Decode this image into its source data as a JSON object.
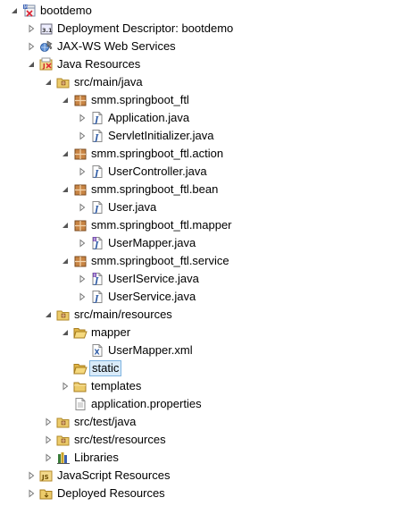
{
  "tree": [
    {
      "id": "bootdemo",
      "label": "bootdemo",
      "depth": 0,
      "arrow": "expanded",
      "icon": "project-icon"
    },
    {
      "id": "deployment-descriptor",
      "label": "Deployment Descriptor: bootdemo",
      "depth": 1,
      "arrow": "collapsed",
      "icon": "deployment-descriptor-icon"
    },
    {
      "id": "jax-ws",
      "label": "JAX-WS Web Services",
      "depth": 1,
      "arrow": "collapsed",
      "icon": "web-services-icon"
    },
    {
      "id": "java-resources",
      "label": "Java Resources",
      "depth": 1,
      "arrow": "expanded",
      "icon": "java-resources-icon"
    },
    {
      "id": "src-main-java",
      "label": "src/main/java",
      "depth": 2,
      "arrow": "expanded",
      "icon": "source-folder-icon"
    },
    {
      "id": "pkg-ftl",
      "label": "smm.springboot_ftl",
      "depth": 3,
      "arrow": "expanded",
      "icon": "package-icon"
    },
    {
      "id": "application-java",
      "label": "Application.java",
      "depth": 4,
      "arrow": "collapsed",
      "icon": "java-file-icon"
    },
    {
      "id": "servletinitializer-java",
      "label": "ServletInitializer.java",
      "depth": 4,
      "arrow": "collapsed",
      "icon": "java-file-icon"
    },
    {
      "id": "pkg-action",
      "label": "smm.springboot_ftl.action",
      "depth": 3,
      "arrow": "expanded",
      "icon": "package-icon"
    },
    {
      "id": "usercontroller-java",
      "label": "UserController.java",
      "depth": 4,
      "arrow": "collapsed",
      "icon": "java-file-icon"
    },
    {
      "id": "pkg-bean",
      "label": "smm.springboot_ftl.bean",
      "depth": 3,
      "arrow": "expanded",
      "icon": "package-icon"
    },
    {
      "id": "user-java",
      "label": "User.java",
      "depth": 4,
      "arrow": "collapsed",
      "icon": "java-file-icon"
    },
    {
      "id": "pkg-mapper",
      "label": "smm.springboot_ftl.mapper",
      "depth": 3,
      "arrow": "expanded",
      "icon": "package-icon"
    },
    {
      "id": "usermapper-java",
      "label": "UserMapper.java",
      "depth": 4,
      "arrow": "collapsed",
      "icon": "java-interface-icon"
    },
    {
      "id": "pkg-service",
      "label": "smm.springboot_ftl.service",
      "depth": 3,
      "arrow": "expanded",
      "icon": "package-icon"
    },
    {
      "id": "useriservice-java",
      "label": "UserIService.java",
      "depth": 4,
      "arrow": "collapsed",
      "icon": "java-interface-icon"
    },
    {
      "id": "userservice-java",
      "label": "UserService.java",
      "depth": 4,
      "arrow": "collapsed",
      "icon": "java-file-icon"
    },
    {
      "id": "src-main-resources",
      "label": "src/main/resources",
      "depth": 2,
      "arrow": "expanded",
      "icon": "source-folder-icon"
    },
    {
      "id": "mapper-folder",
      "label": "mapper",
      "depth": 3,
      "arrow": "expanded",
      "icon": "open-folder-icon"
    },
    {
      "id": "usermapper-xml",
      "label": "UserMapper.xml",
      "depth": 4,
      "arrow": "none",
      "icon": "xml-file-icon"
    },
    {
      "id": "static-folder",
      "label": "static",
      "depth": 3,
      "arrow": "none",
      "icon": "open-folder-icon",
      "selected": true
    },
    {
      "id": "templates-folder",
      "label": "templates",
      "depth": 3,
      "arrow": "collapsed",
      "icon": "folder-icon"
    },
    {
      "id": "application-properties",
      "label": "application.properties",
      "depth": 3,
      "arrow": "none",
      "icon": "properties-file-icon"
    },
    {
      "id": "src-test-java",
      "label": "src/test/java",
      "depth": 2,
      "arrow": "collapsed",
      "icon": "source-folder-icon"
    },
    {
      "id": "src-test-resources",
      "label": "src/test/resources",
      "depth": 2,
      "arrow": "collapsed",
      "icon": "source-folder-icon"
    },
    {
      "id": "libraries",
      "label": "Libraries",
      "depth": 2,
      "arrow": "collapsed",
      "icon": "libraries-icon"
    },
    {
      "id": "javascript-resources",
      "label": "JavaScript Resources",
      "depth": 1,
      "arrow": "collapsed",
      "icon": "javascript-resources-icon"
    },
    {
      "id": "deployed-resources",
      "label": "Deployed Resources",
      "depth": 1,
      "arrow": "collapsed",
      "icon": "deployed-resources-icon"
    }
  ],
  "colors": {
    "selection_bg": "#d9ebf9",
    "selection_border": "#7fb4e0",
    "folder": "#e8c15a",
    "java_blue": "#4a6fb5",
    "package": "#b8763b"
  }
}
